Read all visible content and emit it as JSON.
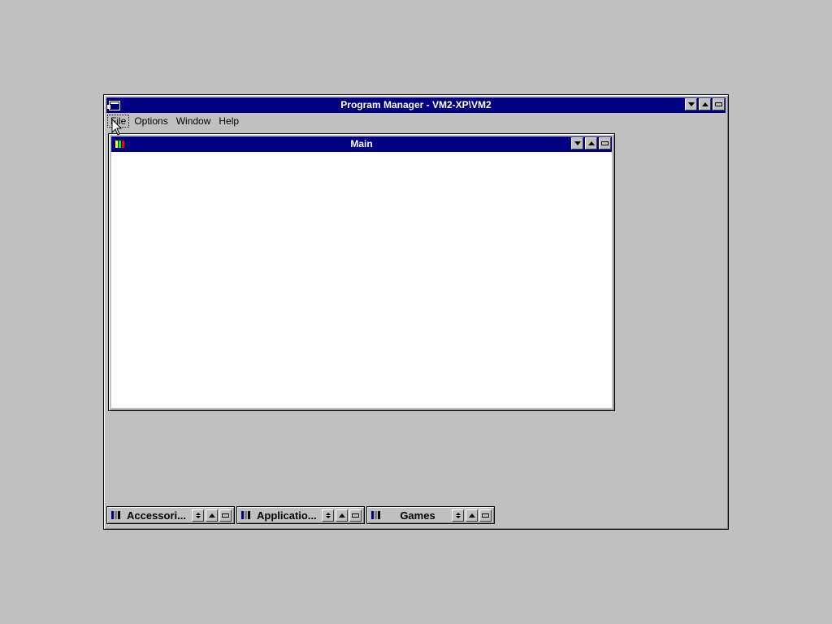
{
  "program_manager": {
    "title": "Program Manager - VM2-XP\\VM2",
    "menu": [
      "File",
      "Options",
      "Window",
      "Help"
    ],
    "active_menu": "File"
  },
  "main_group": {
    "title": "Main"
  },
  "minimized_groups": [
    {
      "label": "Accessori..."
    },
    {
      "label": "Applicatio..."
    },
    {
      "label": "Games"
    }
  ],
  "colors": {
    "desktop": "#c0c0c0",
    "titlebar_active": "#000080",
    "window_client": "#ffffff"
  },
  "icons": {
    "system_menu": "control-menu-icon",
    "minimize": "minimize-icon",
    "maximize": "maximize-icon",
    "restore": "restore-icon",
    "group": "program-group-icon",
    "cursor": "mouse-pointer-icon"
  }
}
